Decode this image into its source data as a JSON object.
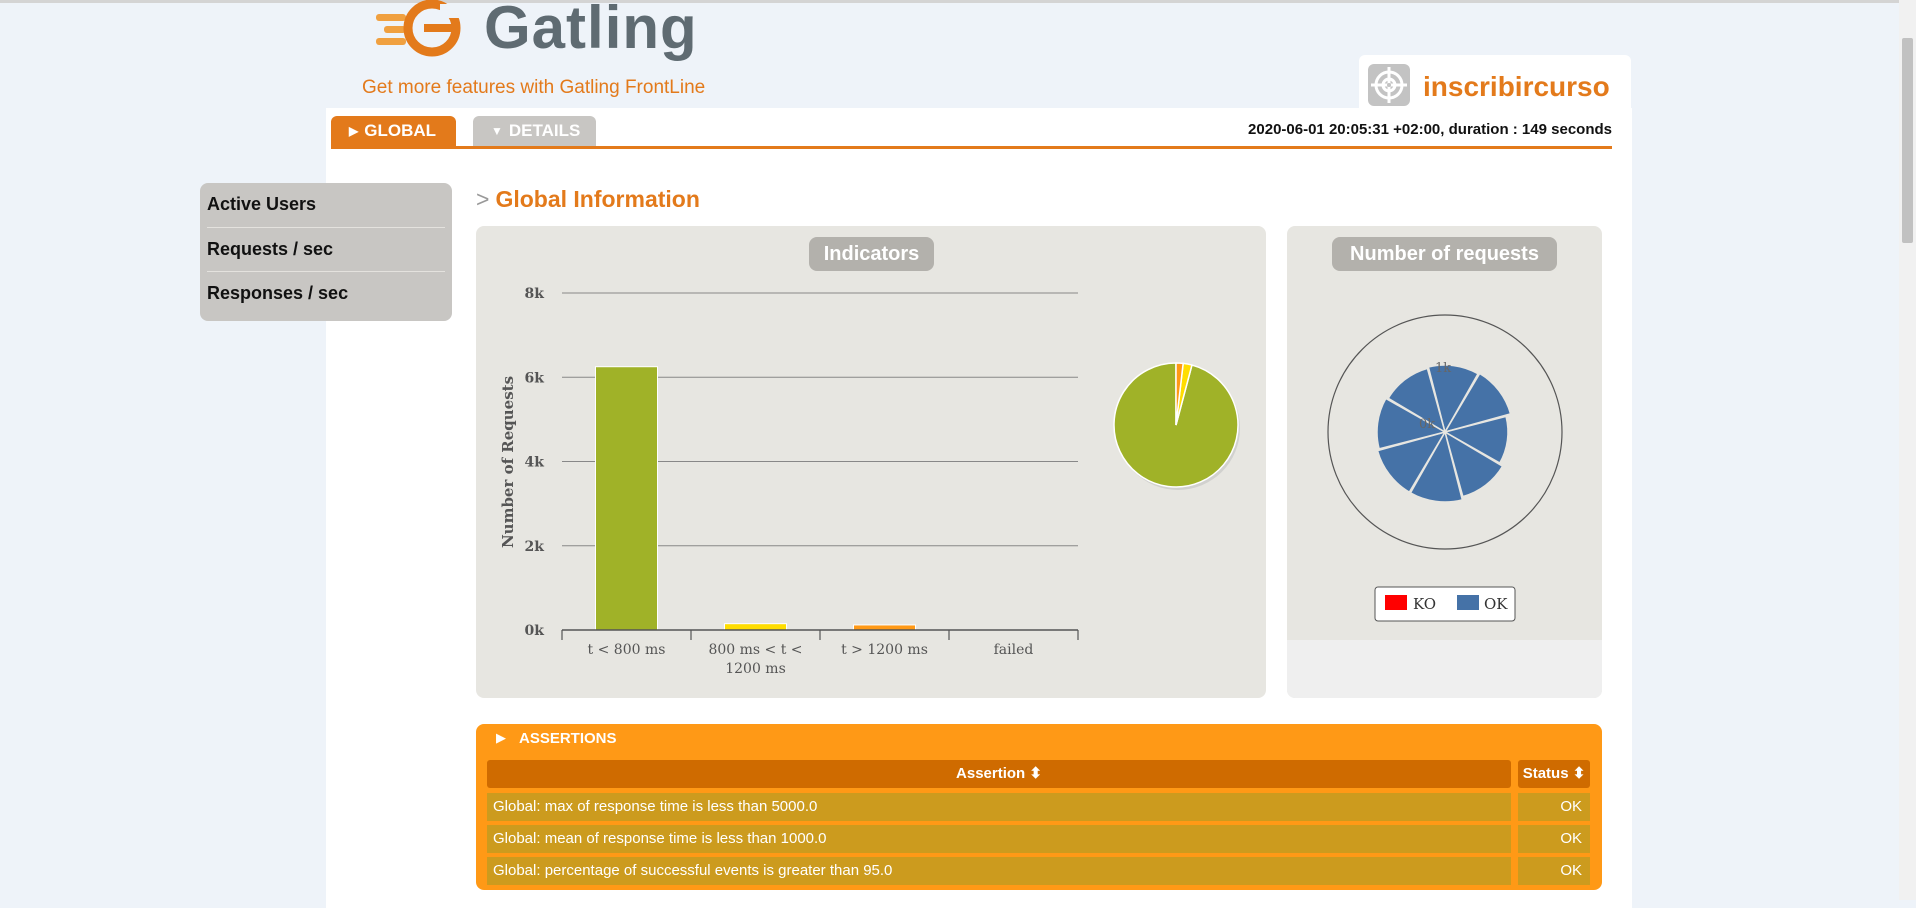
{
  "brand": {
    "name": "Gatling",
    "frontline_link": "Get more features with Gatling FrontLine",
    "colors": {
      "accent": "#e37a1b",
      "green": "#a0b228",
      "yellow": "#ffdd00",
      "orange": "#ff9916",
      "blue": "#4572a7",
      "red": "#ff0000"
    }
  },
  "simulation": {
    "name": "inscribircurso",
    "icon": "target-icon"
  },
  "tabs": [
    {
      "label": "GLOBAL",
      "icon": "triangle-right-icon",
      "active": true
    },
    {
      "label": "DETAILS",
      "icon": "triangle-down-icon",
      "active": false
    }
  ],
  "run_info": "2020-06-01 20:05:31 +02:00, duration : 149 seconds",
  "sidebar": {
    "items": [
      {
        "label": "Active Users"
      },
      {
        "label": "Requests / sec"
      },
      {
        "label": "Responses / sec"
      }
    ]
  },
  "section_title": "Global Information",
  "indicators": {
    "title": "Indicators",
    "chart_data": {
      "type": "bar",
      "ylabel": "Number of Requests",
      "ylim": [
        0,
        8000
      ],
      "yticks": [
        "0k",
        "2k",
        "4k",
        "6k",
        "8k"
      ],
      "categories": [
        {
          "lines": [
            "t < 800 ms"
          ]
        },
        {
          "lines": [
            "800 ms < t <",
            "1200 ms"
          ]
        },
        {
          "lines": [
            "t > 1200 ms"
          ]
        },
        {
          "lines": [
            "failed"
          ]
        }
      ],
      "values": [
        6250,
        150,
        120,
        0
      ],
      "colors": [
        "#a0b228",
        "#ffdd00",
        "#ff9916",
        "#ff0000"
      ],
      "grid": true
    }
  },
  "requests_chart": {
    "title": "Number of requests",
    "tick_labels": [
      "1k",
      "0k"
    ],
    "legend": [
      {
        "label": "KO",
        "color": "#ff0000"
      },
      {
        "label": "OK",
        "color": "#4572a7"
      }
    ]
  },
  "assertions": {
    "title": "ASSERTIONS",
    "headers": {
      "assertion": "Assertion ⬍",
      "status": "Status ⬍"
    },
    "rows": [
      {
        "assertion": "Global: max of response time is less than 5000.0",
        "status": "OK"
      },
      {
        "assertion": "Global: mean of response time is less than 1000.0",
        "status": "OK"
      },
      {
        "assertion": "Global: percentage of successful events is greater than 95.0",
        "status": "OK"
      }
    ]
  }
}
